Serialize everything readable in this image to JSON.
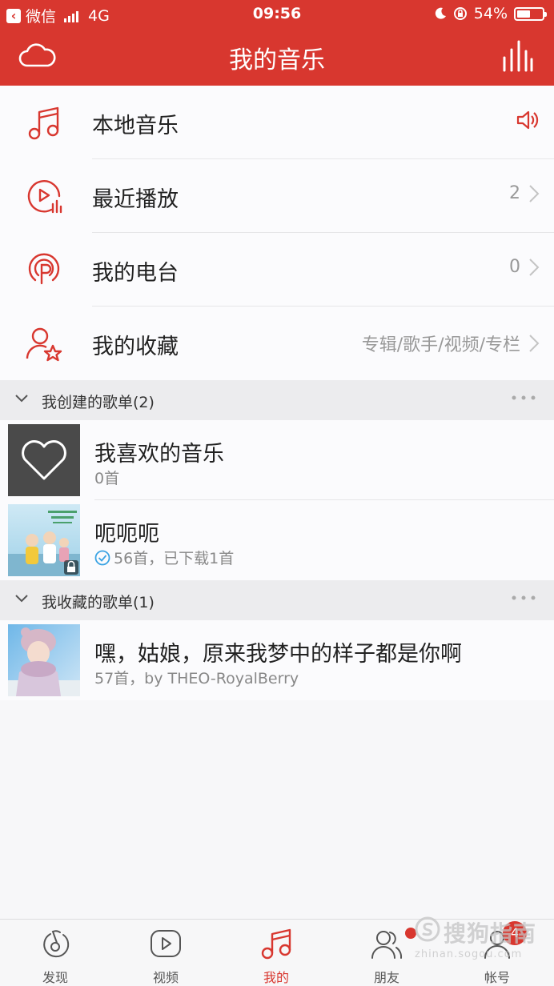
{
  "status_bar": {
    "back_app": "微信",
    "network": "4G",
    "time": "09:56",
    "battery": "54%",
    "battery_level": 0.54
  },
  "header": {
    "title": "我的音乐"
  },
  "menu": [
    {
      "label": "本地音乐",
      "count": "",
      "icon": "music-note-icon"
    },
    {
      "label": "最近播放",
      "count": "2",
      "icon": "recent-play-icon"
    },
    {
      "label": "我的电台",
      "count": "0",
      "icon": "radio-icon"
    },
    {
      "label": "我的收藏",
      "count": "专辑/歌手/视频/专栏",
      "icon": "favorite-user-icon"
    }
  ],
  "created_section": {
    "title": "我创建的歌单(2)",
    "playlists": [
      {
        "name": "我喜欢的音乐",
        "sub": "0首"
      },
      {
        "name": "呃呃呃",
        "sub": "56首，已下载1首"
      }
    ]
  },
  "collected_section": {
    "title": "我收藏的歌单(1)",
    "playlists": [
      {
        "name": "嘿，姑娘，原来我梦中的样子都是你啊",
        "sub": "57首，by THEO-RoyalBerry"
      }
    ]
  },
  "nav": [
    {
      "label": "发现",
      "icon": "discover-icon"
    },
    {
      "label": "视频",
      "icon": "video-icon"
    },
    {
      "label": "我的",
      "icon": "music-note-icon"
    },
    {
      "label": "朋友",
      "icon": "friends-icon"
    },
    {
      "label": "帐号",
      "icon": "account-icon"
    }
  ],
  "account_badge": "4",
  "watermark": {
    "text": "搜狗指南",
    "url": "zhinan.sogou.com"
  },
  "colors": {
    "accent": "#d8372f",
    "check": "#3aa3e3"
  }
}
